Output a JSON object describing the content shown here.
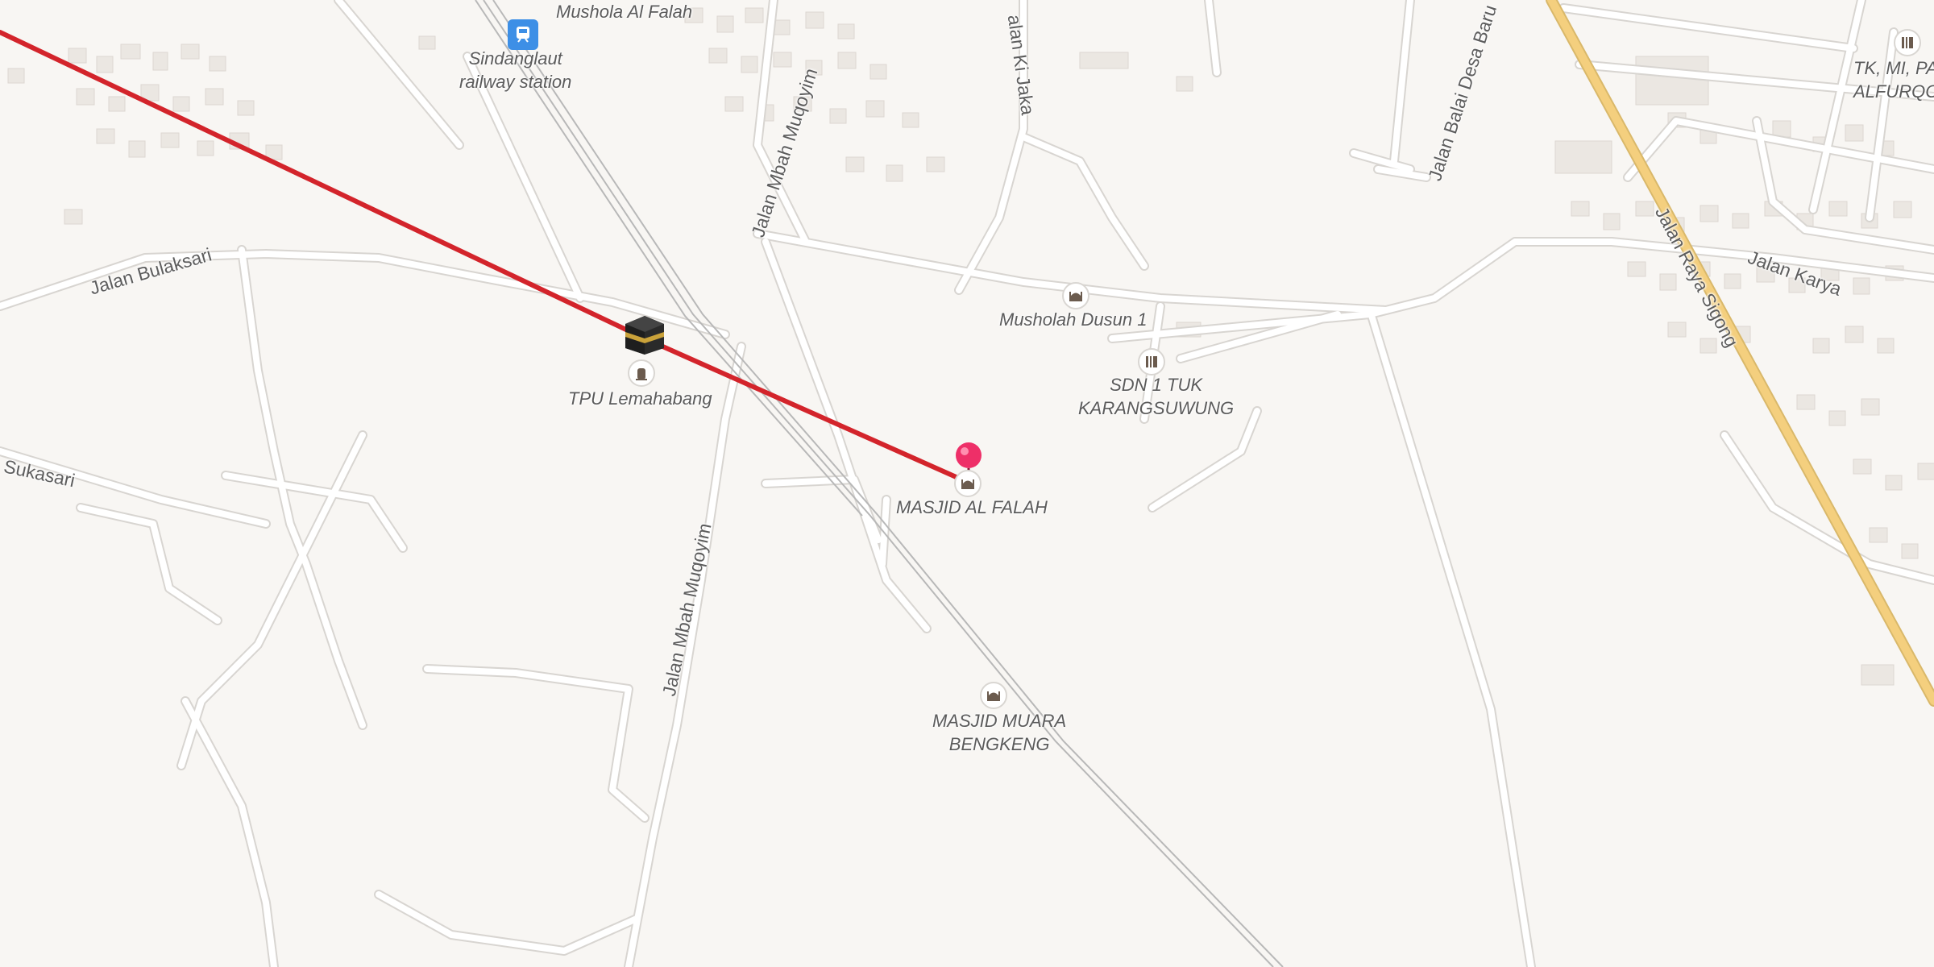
{
  "map": {
    "route_color": "#d3242b",
    "road_color": "#ffffff",
    "road_casing_color": "#d8d5d1",
    "major_road_color": "#f4cf7e",
    "building_color": "#ebe7e2",
    "railway_color": "#b8b8b8"
  },
  "labels": {
    "mushola_al_falah": "Mushola Al Falah",
    "station_line1": "Sindanglaut",
    "station_line2": "railway station",
    "tpu": "TPU Lemahabang",
    "musholah_dusun": "Musholah Dusun 1",
    "sdn_line1": "SDN 1 TUK",
    "sdn_line2": "KARANGSUWUNG",
    "masjid_al_falah": "MASJID AL FALAH",
    "masjid_muara_line1": "MASJID MUARA",
    "masjid_muara_line2": "BENGKENG",
    "tk_line1": "TK, MI, PA",
    "tk_line2": "ALFURQO"
  },
  "streets": {
    "bulaksari": "Jalan Bulaksari",
    "sukasari": "Sukasari",
    "mbah_muqoyim_north": "Jalan Mbah Muqoyim",
    "mbah_muqoyim_south": "Jalan Mbah Muqoyim",
    "ki_jaka": "alan Ki Jaka",
    "balai_desa": "Jalan Balai Desa Baru",
    "raya_sigong": "Jalan Raya Sigong",
    "karya": "Jalan Karya"
  },
  "icons": {
    "route": "route-line",
    "destination": "map-pin-icon",
    "kaaba": "kaaba-icon",
    "mosque": "mosque-icon",
    "school": "school-icon",
    "cemetery": "cemetery-icon",
    "train": "train-icon"
  }
}
